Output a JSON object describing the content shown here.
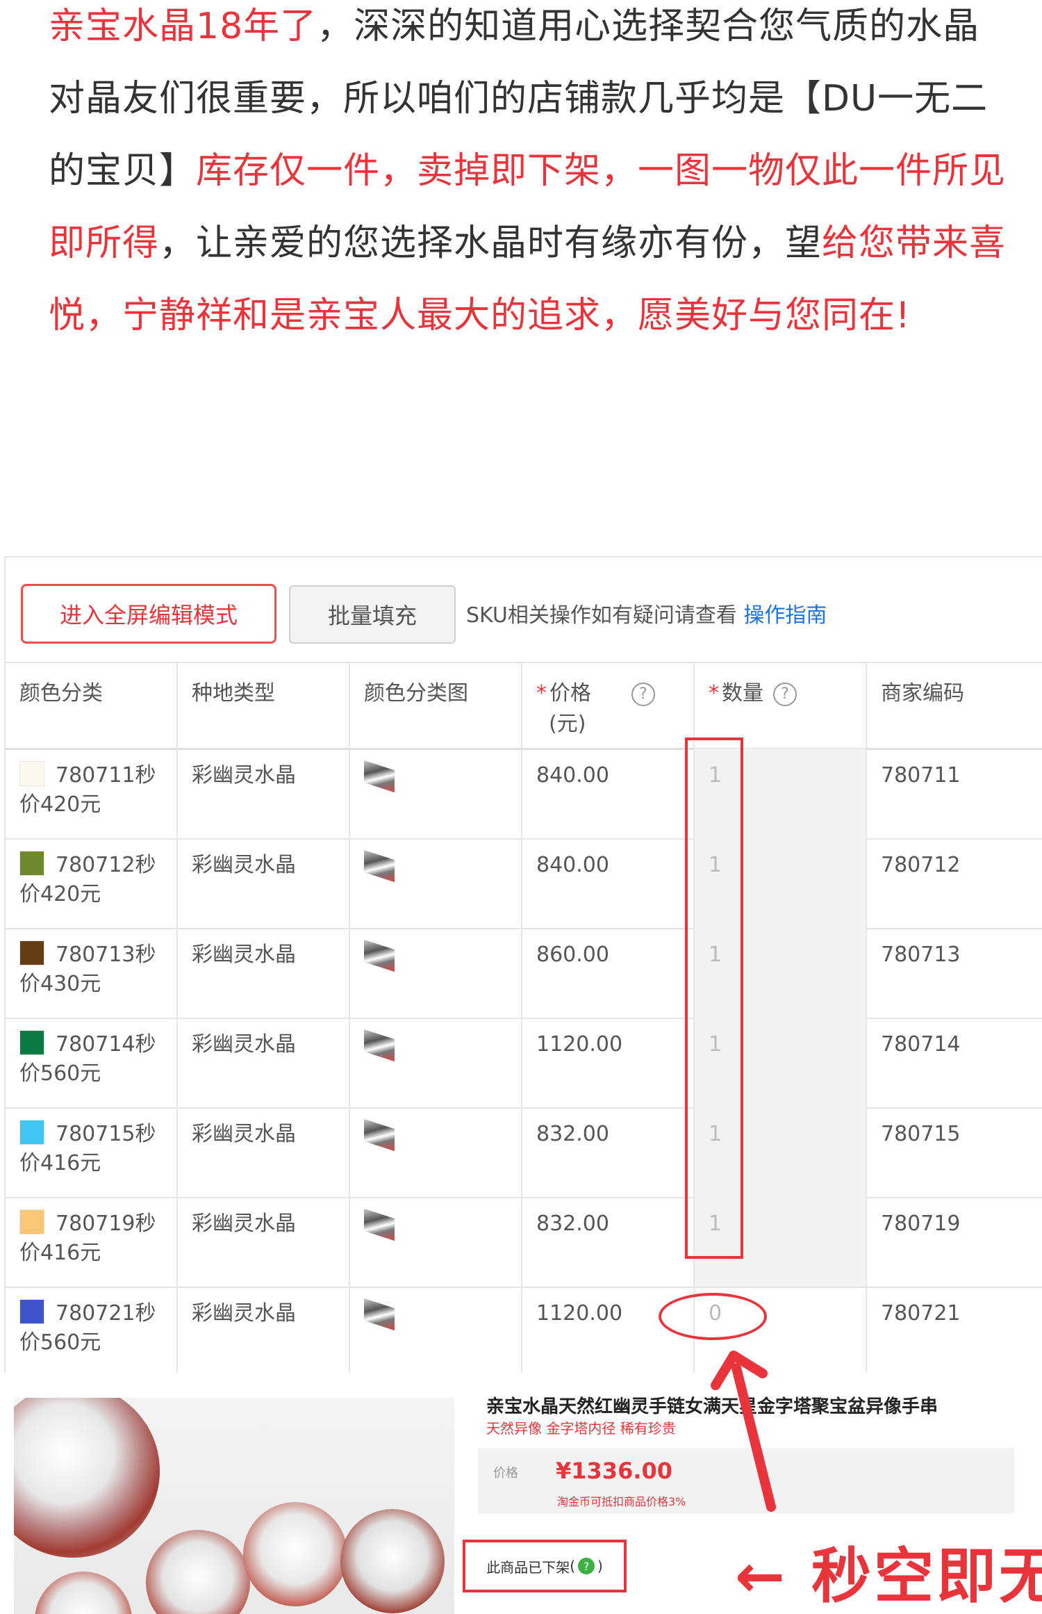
{
  "intro": {
    "p1_red": "亲宝水晶18年了",
    "p1_text": "，深深的知道用心选择契合您气质的水晶对晶友们很重要，所以咱们的店铺款几乎均是【DU一无二的宝贝】",
    "p2_red": "库存仅一件，卖掉即下架，一图一物仅此一件所见即所得",
    "p3_text": "，让亲爱的您选择水晶时有缘亦有份，望",
    "p4_red": "给您带来喜悦，宁静祥和是亲宝人最大的追求，愿美好与您同在!"
  },
  "toolbar": {
    "fullscreen_label": "进入全屏编辑模式",
    "batch_label": "批量填充",
    "tip_text": "SKU相关操作如有疑问请查看",
    "guide_link": "操作指南"
  },
  "table": {
    "headers": {
      "color": "颜色分类",
      "type": "种地类型",
      "image": "颜色分类图",
      "price_star": "*",
      "price": "价格",
      "price_unit": "(元)",
      "qty_star": "*",
      "qty": "数量",
      "code": "商家编码"
    },
    "help_glyph": "?",
    "rows": [
      {
        "color_name": "780711秒价420元",
        "swatch": "#fdf8ec",
        "type": "彩幽灵水晶",
        "price": "840.00",
        "qty": "1",
        "code": "780711"
      },
      {
        "color_name": "780712秒价420元",
        "swatch": "#6f8a2e",
        "type": "彩幽灵水晶",
        "price": "840.00",
        "qty": "1",
        "code": "780712"
      },
      {
        "color_name": "780713秒价430元",
        "swatch": "#663d12",
        "type": "彩幽灵水晶",
        "price": "860.00",
        "qty": "1",
        "code": "780713"
      },
      {
        "color_name": "780714秒价560元",
        "swatch": "#0e7a43",
        "type": "彩幽灵水晶",
        "price": "1120.00",
        "qty": "1",
        "code": "780714"
      },
      {
        "color_name": "780715秒价416元",
        "swatch": "#3fc6f2",
        "type": "彩幽灵水晶",
        "price": "832.00",
        "qty": "1",
        "code": "780715"
      },
      {
        "color_name": "780719秒价416元",
        "swatch": "#f7c776",
        "type": "彩幽灵水晶",
        "price": "832.00",
        "qty": "1",
        "code": "780719"
      },
      {
        "color_name": "780721秒价560元",
        "swatch": "#3d55c9",
        "type": "彩幽灵水晶",
        "price": "1120.00",
        "qty": "0",
        "code": "780721"
      }
    ]
  },
  "product": {
    "title": "亲宝水晶天然红幽灵手链女满天星金字塔聚宝盆异像手串",
    "subtitle": "天然异像 金字塔内径 稀有珍贵",
    "price_label": "价格",
    "price": "¥1336.00",
    "price_note": "淘金币可抵扣商品价格3%",
    "offshelf": "此商品已下架",
    "offshelf_badge": "?",
    "big_label": "← 秒空即无"
  },
  "colors": {
    "accent_red": "#e8343a",
    "link_blue": "#1a73e8"
  }
}
